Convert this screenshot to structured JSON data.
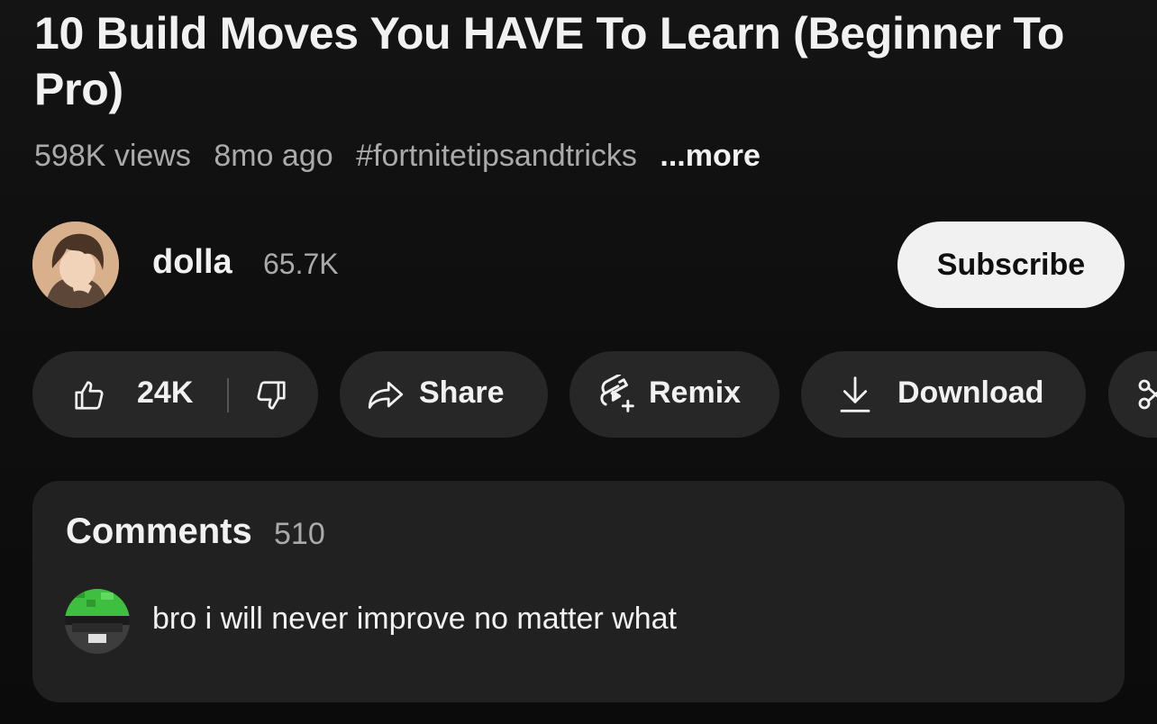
{
  "video": {
    "title": "10 Build Moves You HAVE To Learn (Beginner To Pro)",
    "views": "598K views",
    "age": "8mo ago",
    "hashtag": "#fortnitetipsandtricks",
    "more_label": "...more"
  },
  "channel": {
    "name": "dolla",
    "subscribers": "65.7K",
    "subscribe_label": "Subscribe"
  },
  "actions": {
    "like_count": "24K",
    "share_label": "Share",
    "remix_label": "Remix",
    "download_label": "Download",
    "icons": [
      "thumbs-up-icon",
      "thumbs-down-icon",
      "share-arrow-icon",
      "remix-icon",
      "download-icon",
      "scissors-icon"
    ]
  },
  "comments": {
    "title": "Comments",
    "count": "510",
    "top_comment": {
      "text": "bro i will never improve no matter what"
    }
  },
  "colors": {
    "background": "#0f0f0f",
    "pill": "#272727",
    "panel": "#212121",
    "text_primary": "#f1f1f1",
    "text_secondary": "#aaaaaa",
    "subscribe_bg": "#f1f1f1"
  }
}
